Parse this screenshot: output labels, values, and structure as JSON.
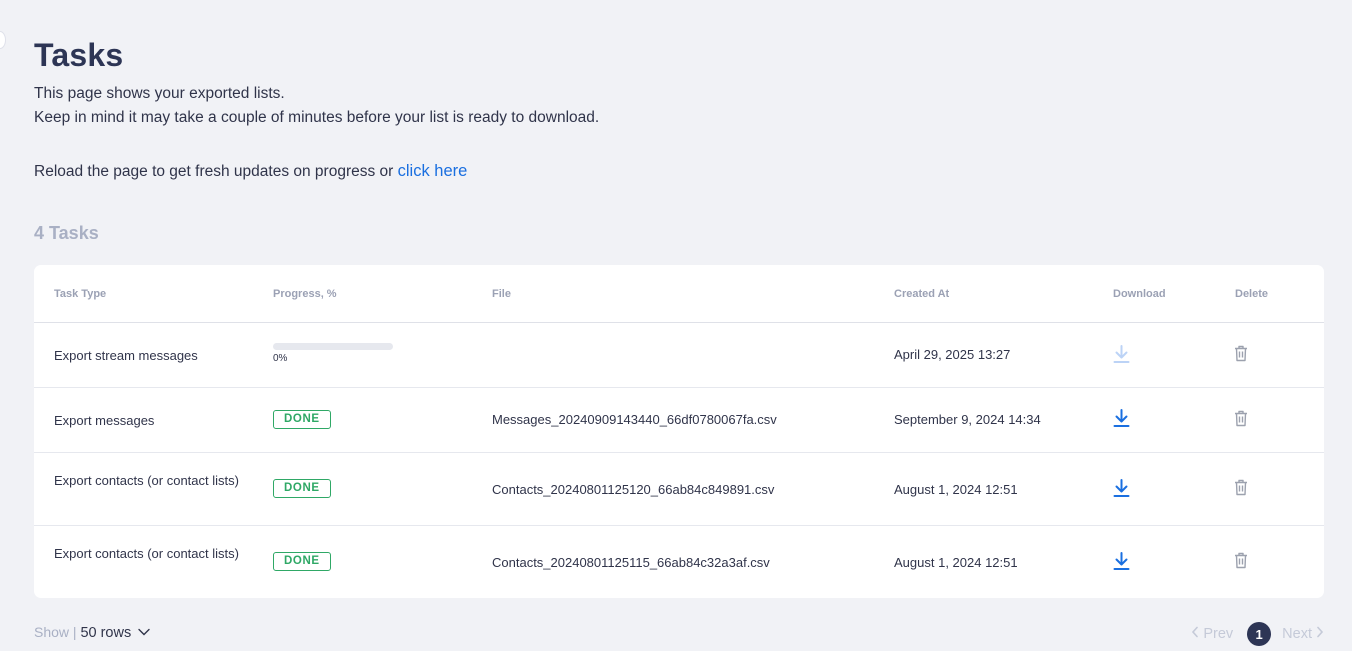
{
  "page": {
    "title": "Tasks",
    "description_line1": "This page shows your exported lists.",
    "description_line2": "Keep in mind it may take a couple of minutes before your list is ready to download.",
    "reload_text": "Reload the page to get fresh updates on progress or ",
    "reload_link": "click here",
    "task_count": "4 Tasks"
  },
  "table": {
    "headers": {
      "task_type": "Task Type",
      "progress": "Progress, %",
      "file": "File",
      "created_at": "Created At",
      "download": "Download",
      "delete": "Delete"
    },
    "rows": [
      {
        "task_type": "Export stream messages",
        "progress_label": "0%",
        "progress_value": 0,
        "file": "",
        "created_at": "April 29, 2025 13:27",
        "download_enabled": false
      },
      {
        "task_type": "Export messages",
        "status": "DONE",
        "file": "Messages_20240909143440_66df0780067fa.csv",
        "created_at": "September 9, 2024 14:34",
        "download_enabled": true
      },
      {
        "task_type": "Export contacts (or contact lists)",
        "status": "DONE",
        "file": "Contacts_20240801125120_66ab84c849891.csv",
        "created_at": "August 1, 2024 12:51",
        "download_enabled": true
      },
      {
        "task_type": "Export contacts (or contact lists)",
        "status": "DONE",
        "file": "Contacts_20240801125115_66ab84c32a3af.csv",
        "created_at": "August 1, 2024 12:51",
        "download_enabled": true
      }
    ]
  },
  "footer": {
    "show_label": "Show |",
    "rows_label": "50 rows",
    "prev_label": "Prev",
    "next_label": "Next",
    "current_page": "1"
  },
  "icons": {
    "download": "download-icon",
    "delete": "trash-icon",
    "chevron_down": "chevron-down-icon",
    "chevron_left": "chevron-left-icon",
    "chevron_right": "chevron-right-icon"
  },
  "colors": {
    "accent": "#1a6fe0",
    "done": "#2fa866",
    "title": "#2d3555",
    "muted": "#a9b0c4",
    "background": "#f1f2f6"
  }
}
